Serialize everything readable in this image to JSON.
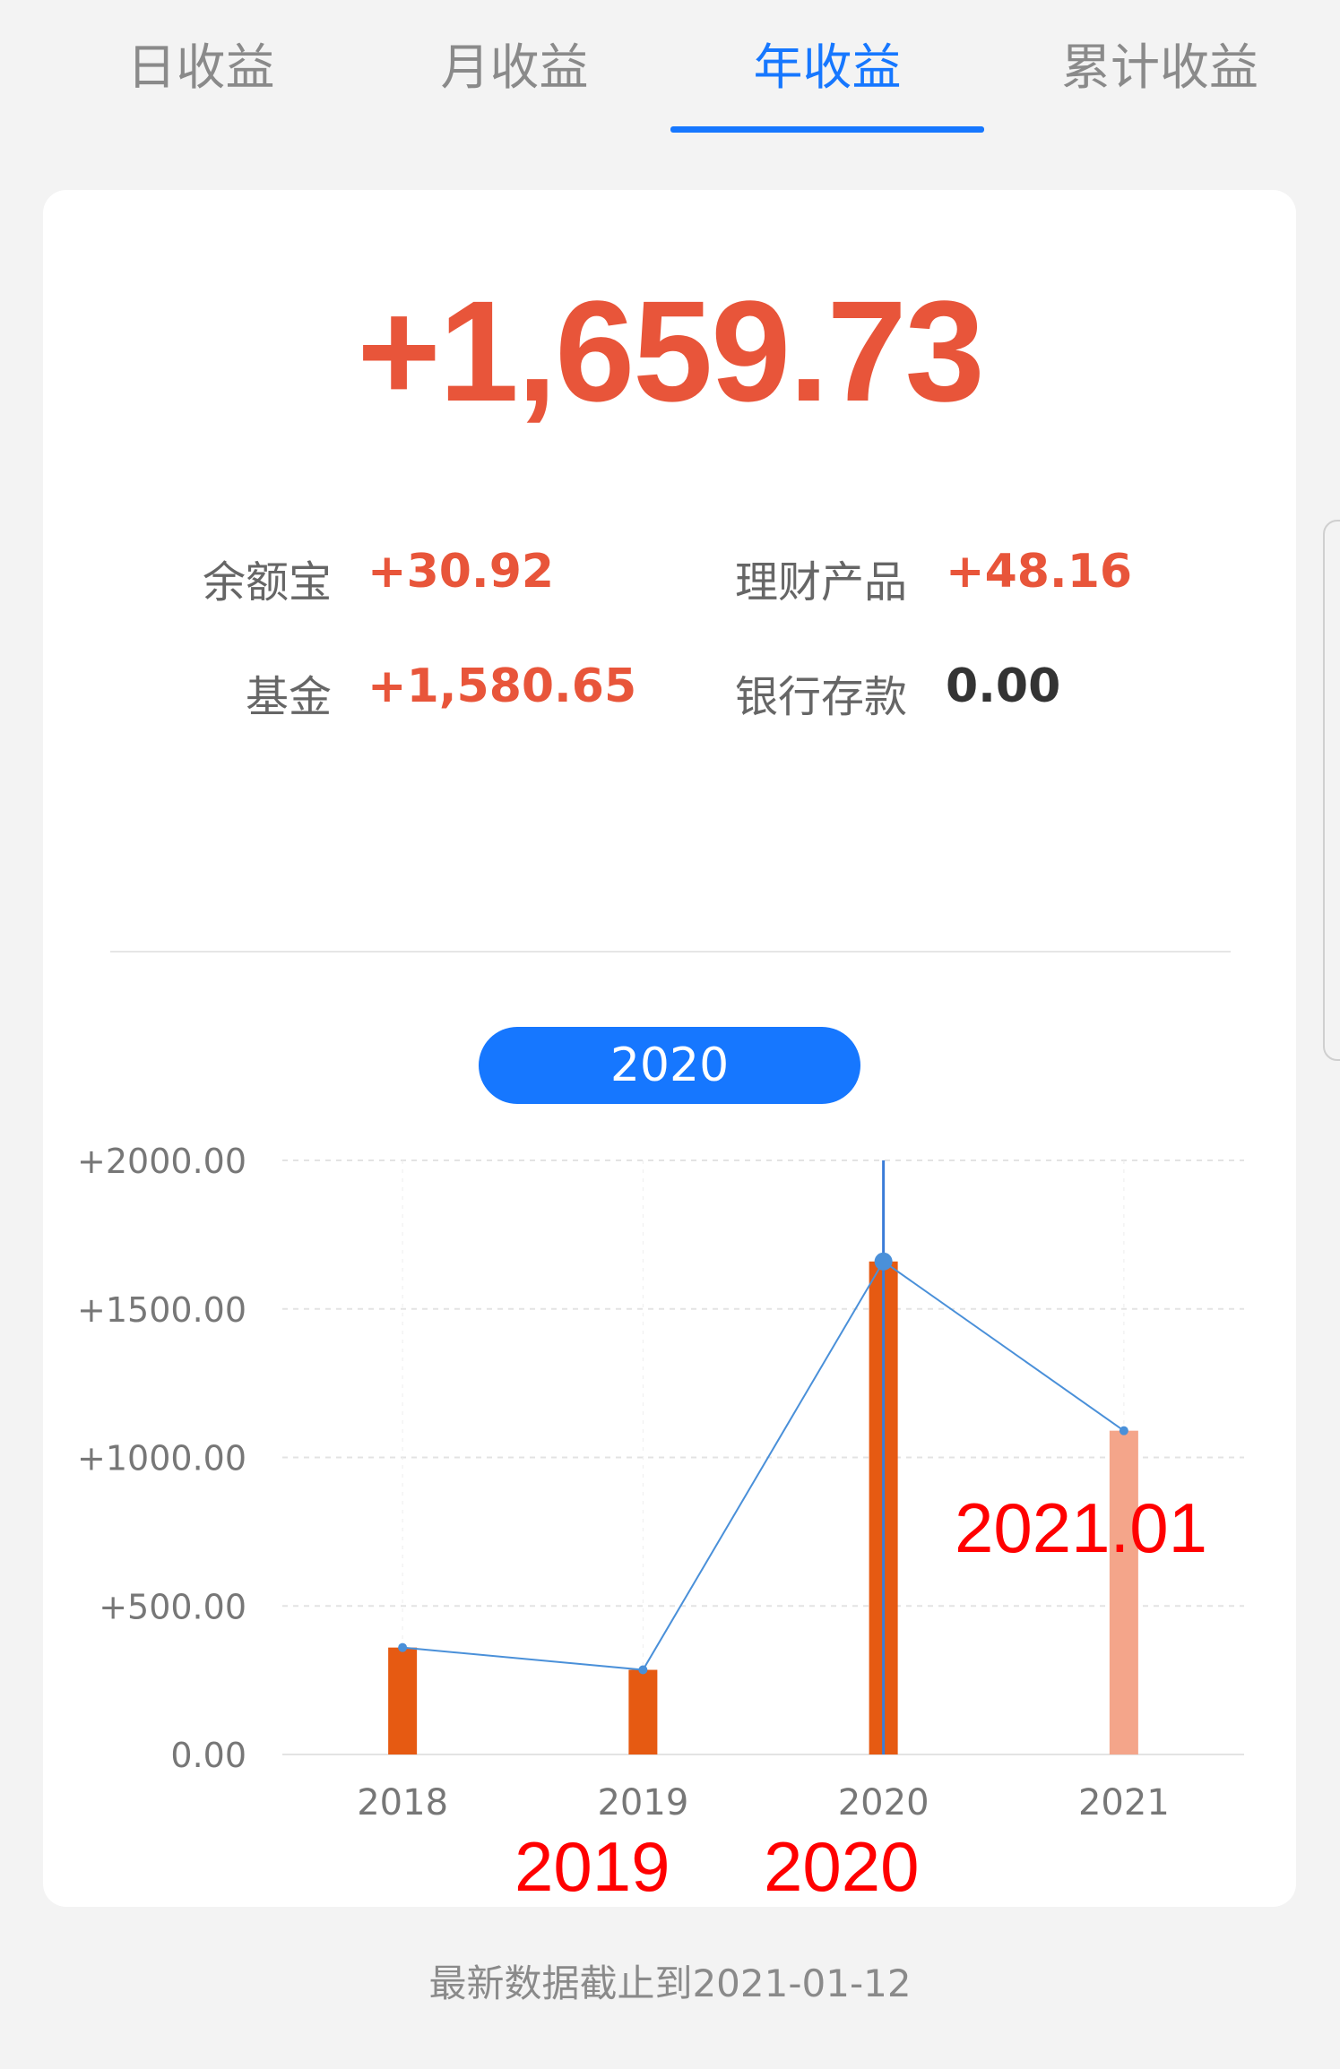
{
  "tabs": [
    {
      "label": "日收益",
      "active": false
    },
    {
      "label": "月收益",
      "active": false
    },
    {
      "label": "年收益",
      "active": true
    },
    {
      "label": "累计收益",
      "active": false
    }
  ],
  "summary": {
    "total": "+1,659.73",
    "breakdown": [
      {
        "label": "余额宝",
        "value": "+30.92"
      },
      {
        "label": "理财产品",
        "value": "+48.16"
      },
      {
        "label": "基金",
        "value": "+1,580.65"
      },
      {
        "label": "银行存款",
        "value": "0.00"
      }
    ]
  },
  "selected_year": "2020",
  "chart_data": {
    "type": "bar",
    "categories": [
      "2018",
      "2019",
      "2020",
      "2021"
    ],
    "values": [
      360,
      285,
      1659.73,
      1090
    ],
    "y_ticks": [
      "+2000.00",
      "+1500.00",
      "+1000.00",
      "+500.00",
      "0.00"
    ],
    "ylim": [
      0,
      2000
    ],
    "selected_index": 2,
    "colors": {
      "bar": "#e65a12",
      "bar_pending": "#f4a58a",
      "line": "#4a90d9",
      "grid": "#e3e3e3"
    }
  },
  "annotations": [
    "2021.01",
    "2019",
    "2020"
  ],
  "footer": "最新数据截止到2021-01-12"
}
